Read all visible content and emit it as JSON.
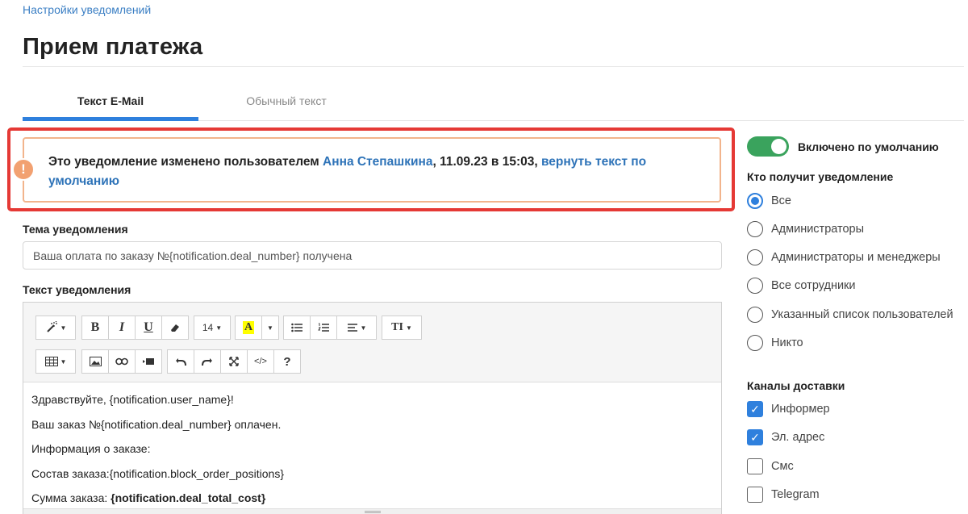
{
  "breadcrumb": "Настройки уведомлений",
  "page_title": "Прием платежа",
  "tabs": [
    {
      "label": "Текст E-Mail",
      "active": true
    },
    {
      "label": "Обычный текст",
      "active": false
    }
  ],
  "notice": {
    "icon": "!",
    "prefix": "Это уведомление изменено пользователем ",
    "user": "Анна Степашкина",
    "date": ", 11.09.23 в 15:03, ",
    "revert_link": "вернуть текст по умолчанию"
  },
  "subject": {
    "label": "Тема уведомления",
    "value": "Ваша оплата по заказу №{notification.deal_number} получена"
  },
  "body_editor": {
    "label": "Текст уведомления",
    "toolbar": {
      "bold": "B",
      "italic": "I",
      "underline": "U",
      "font_size": "14",
      "color": "A",
      "text_height": "TI",
      "help": "?",
      "code": "</>"
    },
    "lines": [
      "Здравствуйте, {notification.user_name}!",
      "Ваш заказ №{notification.deal_number} оплачен.",
      "Информация о заказе:",
      "Состав заказа:{notification.block_order_positions}"
    ],
    "total_label": "Сумма заказа: ",
    "total_value": "{notification.deal_total_cost}"
  },
  "sidebar": {
    "toggle_label": "Включено по умолчанию",
    "toggle_on": true,
    "recipients_heading": "Кто получит уведомление",
    "recipients": [
      {
        "label": "Все",
        "selected": true
      },
      {
        "label": "Администраторы",
        "selected": false
      },
      {
        "label": "Администраторы и менеджеры",
        "selected": false
      },
      {
        "label": "Все сотрудники",
        "selected": false
      },
      {
        "label": "Указанный список пользователей",
        "selected": false
      },
      {
        "label": "Никто",
        "selected": false
      }
    ],
    "channels_heading": "Каналы доставки",
    "channels": [
      {
        "label": "Информер",
        "checked": true
      },
      {
        "label": "Эл. адрес",
        "checked": true
      },
      {
        "label": "Смс",
        "checked": false
      },
      {
        "label": "Telegram",
        "checked": false
      }
    ]
  },
  "colors": {
    "accent": "#2f80dd",
    "link": "#2e73b8",
    "highlight_frame": "#e53935",
    "notice_border": "#f2b48c",
    "toggle_on": "#3aa35d"
  }
}
